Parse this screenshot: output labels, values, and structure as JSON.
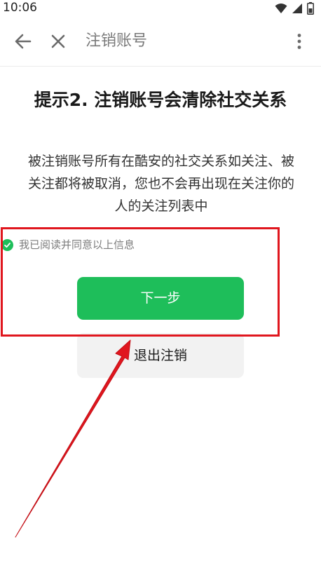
{
  "status_bar": {
    "time": "10:06",
    "icons": [
      "wifi-icon",
      "signal-icon",
      "battery-icon"
    ]
  },
  "toolbar": {
    "title": "注销账号",
    "icons": [
      "back-arrow-icon",
      "close-icon",
      "more-vert-icon"
    ]
  },
  "content": {
    "heading": "提示2. 注销账号会清除社交关系",
    "body": "被注销账号所有在酷安的社交关系如关注、被关注都将被取消，您也不会再出现在关注你的人的关注列表中",
    "agree_label": "我已阅读并同意以上信息",
    "agree_checked": true,
    "next_button": "下一步",
    "cancel_button": "退出注销"
  },
  "colors": {
    "accent_green": "#1ebe5a",
    "annotation_red": "#e0161e",
    "secondary_button_bg": "#f2f2f2"
  }
}
